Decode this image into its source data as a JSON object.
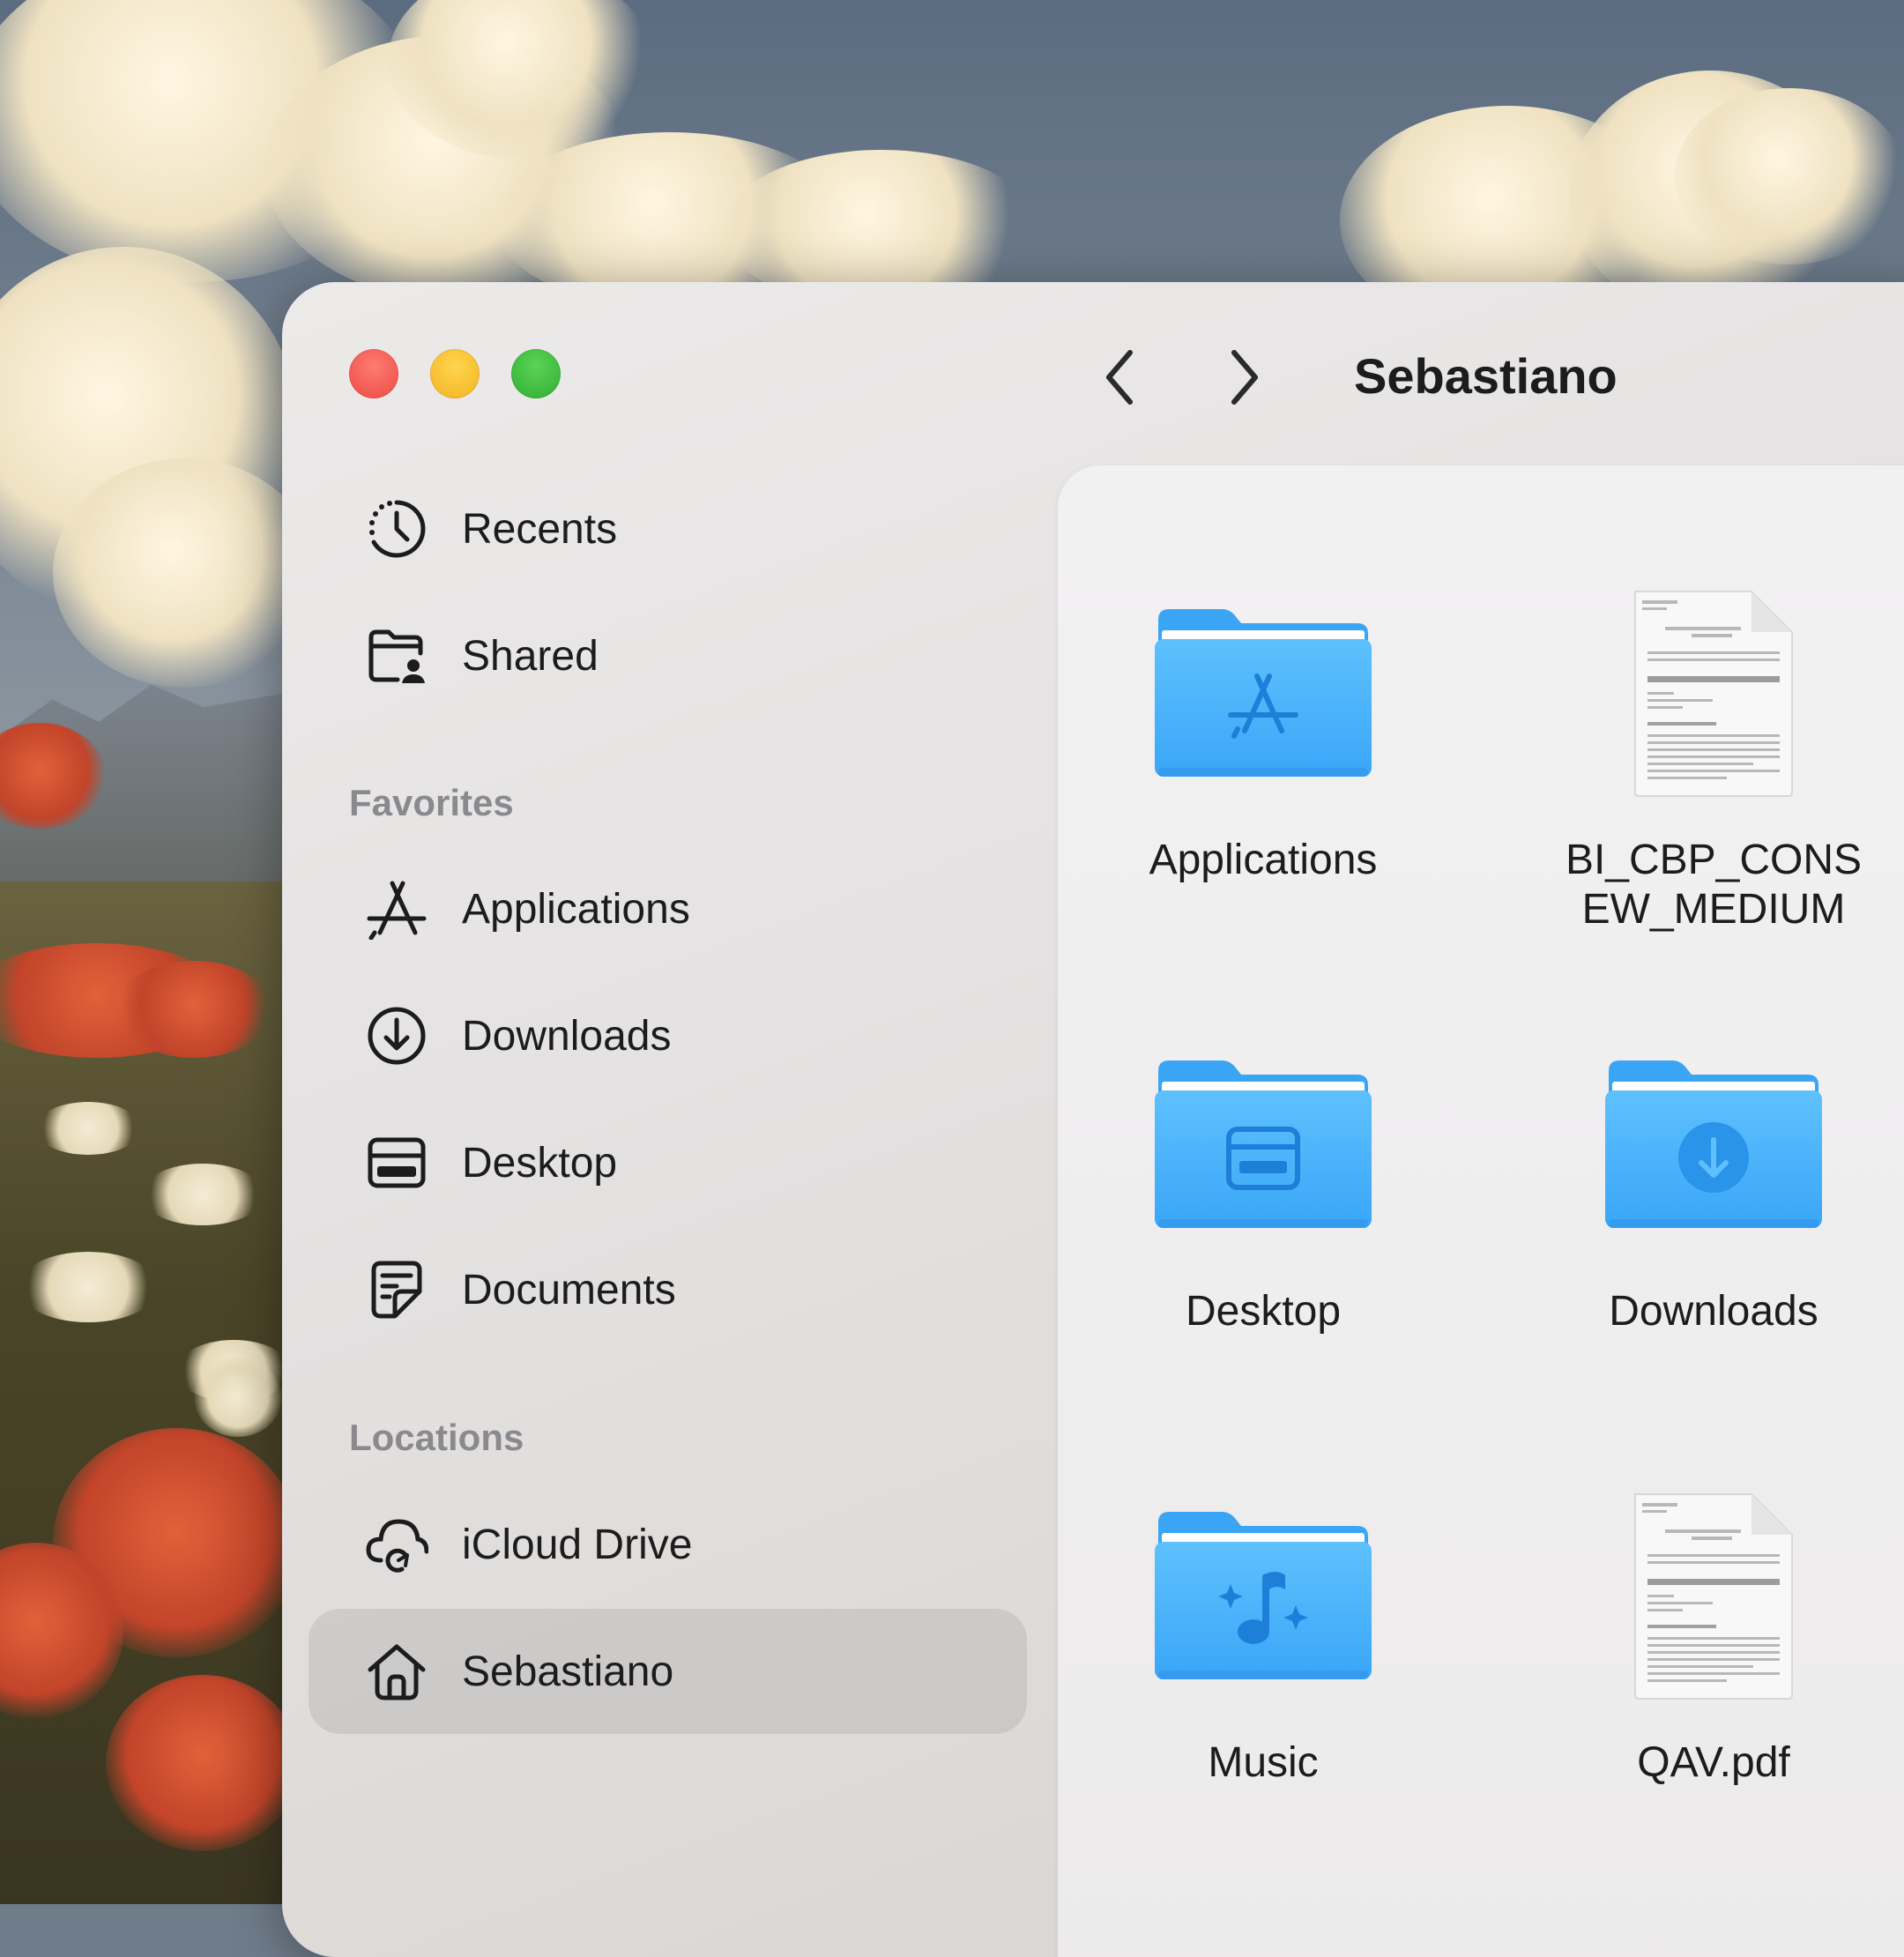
{
  "window": {
    "title": "Sebastiano"
  },
  "sidebar": {
    "items_top": [
      {
        "label": "Recents",
        "icon": "clock-icon"
      },
      {
        "label": "Shared",
        "icon": "shared-folder-icon"
      }
    ],
    "favorites": {
      "header": "Favorites",
      "items": [
        {
          "label": "Applications",
          "icon": "app-store-icon"
        },
        {
          "label": "Downloads",
          "icon": "download-circle-icon"
        },
        {
          "label": "Desktop",
          "icon": "desktop-icon"
        },
        {
          "label": "Documents",
          "icon": "document-icon"
        }
      ]
    },
    "locations": {
      "header": "Locations",
      "items": [
        {
          "label": "iCloud Drive",
          "icon": "icloud-icon"
        },
        {
          "label": "Sebastiano",
          "icon": "home-icon",
          "selected": true
        }
      ]
    }
  },
  "content": {
    "files": [
      {
        "name": "Applications",
        "kind": "folder",
        "icon": "applications-folder-icon"
      },
      {
        "name": "BI_CBP_CONS\nEW_MEDIUM",
        "kind": "document",
        "icon": "document-thumbnail-icon"
      },
      {
        "name": "Desktop",
        "kind": "folder",
        "icon": "desktop-folder-icon"
      },
      {
        "name": "Downloads",
        "kind": "folder",
        "icon": "downloads-folder-icon"
      },
      {
        "name": "Music",
        "kind": "folder",
        "icon": "music-folder-icon"
      },
      {
        "name": "QAV.pdf",
        "kind": "document",
        "icon": "pdf-thumbnail-icon"
      }
    ]
  },
  "colors": {
    "folder_blue": "#4bb3fb",
    "folder_blue_dark": "#2f96ee",
    "traffic_red": "#ee4c44",
    "traffic_yellow": "#f5b623",
    "traffic_green": "#33b035"
  }
}
